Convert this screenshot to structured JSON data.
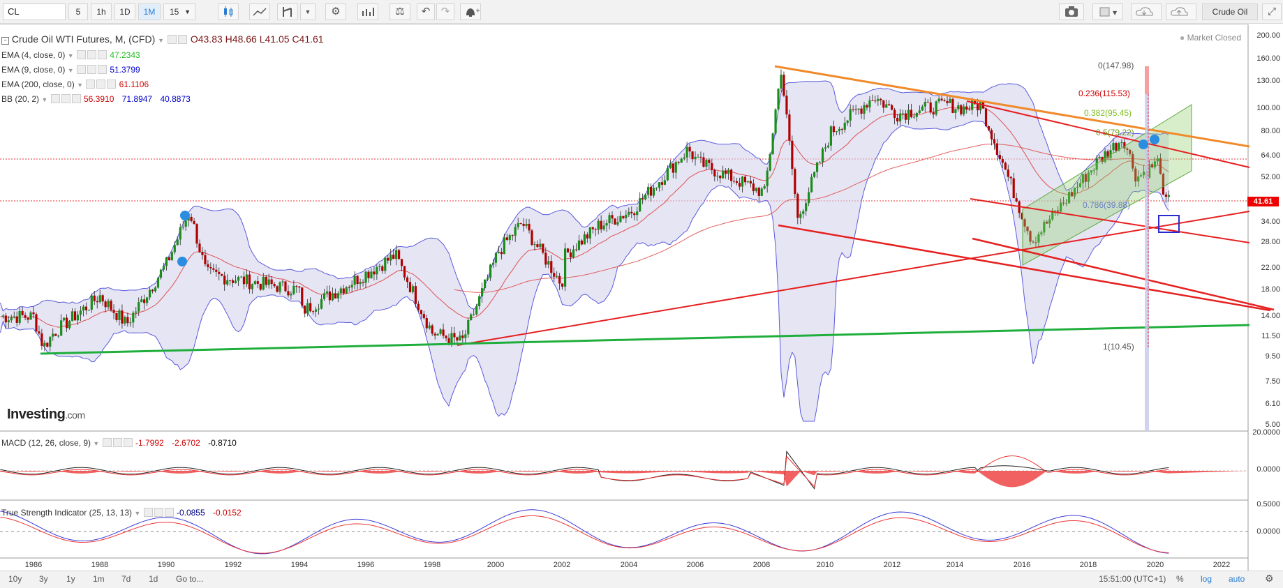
{
  "toolbar": {
    "symbol": "CL",
    "intervals": [
      "5",
      "1h",
      "1D",
      "1M",
      "15"
    ],
    "active_interval": "1M",
    "icons": [
      "candlestick-icon",
      "line-chart-icon",
      "draw-tools-icon",
      "dropdown-icon",
      "settings-icon",
      "indicators-icon",
      "compare-icon",
      "undo-icon",
      "redo-icon",
      "alert-icon",
      "camera-icon",
      "square-icon",
      "cloud-download-icon",
      "cloud-upload-icon",
      "fullscreen-icon"
    ],
    "instrument_button": "Crude Oil"
  },
  "main_legend": {
    "title": "Crude Oil WTI Futures, M, (CFD)",
    "open": "O43.83",
    "high": "H48.66",
    "low": "L41.05",
    "close": "C41.61",
    "market_status": "Market Closed"
  },
  "indicators": [
    {
      "name": "EMA (4, close, 0)",
      "values": [
        "47.2343"
      ],
      "colors": [
        "#22c022"
      ]
    },
    {
      "name": "EMA (9, close, 0)",
      "values": [
        "51.3799"
      ],
      "colors": [
        "#0000cc"
      ]
    },
    {
      "name": "EMA (200, close, 0)",
      "values": [
        "61.1106"
      ],
      "colors": [
        "#cc0000"
      ]
    },
    {
      "name": "BB (20, 2)",
      "values": [
        "56.3910",
        "71.8947",
        "40.8873"
      ],
      "colors": [
        "#cc0000",
        "#0000cc",
        "#0000cc"
      ]
    }
  ],
  "macd": {
    "name": "MACD (12, 26, close, 9)",
    "values": [
      "-1.7992",
      "-2.6702",
      "-0.8710"
    ],
    "colors": [
      "#cc0000",
      "#cc0000",
      "#000000"
    ]
  },
  "tsi": {
    "name": "True Strength Indicator (25, 13, 13)",
    "values": [
      "-0.0855",
      "-0.0152"
    ],
    "colors": [
      "#000080",
      "#cc0000"
    ]
  },
  "price_axis": [
    "200.00",
    "160.00",
    "130.00",
    "100.00",
    "80.00",
    "64.00",
    "52.00",
    "41.61",
    "34.00",
    "28.00",
    "22.00",
    "18.00",
    "14.00",
    "11.50",
    "9.50",
    "7.50",
    "6.10",
    "5.00"
  ],
  "macd_axis": [
    "20.0000",
    "0.0000"
  ],
  "tsi_axis": [
    "0.5000",
    "0.0000"
  ],
  "current_price": "41.61",
  "fib_levels": [
    "0(147.98)",
    "0.236(115.53)",
    "0.382(95.45)",
    "0.5(79.22)",
    "0.786(39.88)",
    "1(10.45)"
  ],
  "time_axis": [
    "1986",
    "1988",
    "1990",
    "1992",
    "1994",
    "1996",
    "1998",
    "2000",
    "2002",
    "2004",
    "2006",
    "2008",
    "2010",
    "2012",
    "2014",
    "2016",
    "2018",
    "2020",
    "2022"
  ],
  "watermark": {
    "brand": "Investing",
    "suffix": ".com"
  },
  "bottom_bar": {
    "periods": [
      "10y",
      "3y",
      "1y",
      "1m",
      "7d",
      "1d"
    ],
    "goto": "Go to...",
    "time": "15:51:00 (UTC+1)",
    "scale_options": [
      "%",
      "log",
      "auto"
    ],
    "active_scale": [
      "log",
      "auto"
    ]
  },
  "chart_data": {
    "type": "candlestick",
    "title": "Crude Oil WTI Futures, M, (CFD)",
    "x": [
      1986,
      1988,
      1990,
      1992,
      1994,
      1996,
      1998,
      2000,
      2002,
      2004,
      2006,
      2008,
      2010,
      2012,
      2014,
      2016,
      2018,
      2020
    ],
    "close": [
      14,
      17,
      23,
      20,
      18,
      21,
      12,
      26,
      25,
      38,
      60,
      45,
      80,
      95,
      100,
      30,
      60,
      41.61
    ],
    "yscale": "log",
    "ylim": [
      5,
      200
    ]
  }
}
